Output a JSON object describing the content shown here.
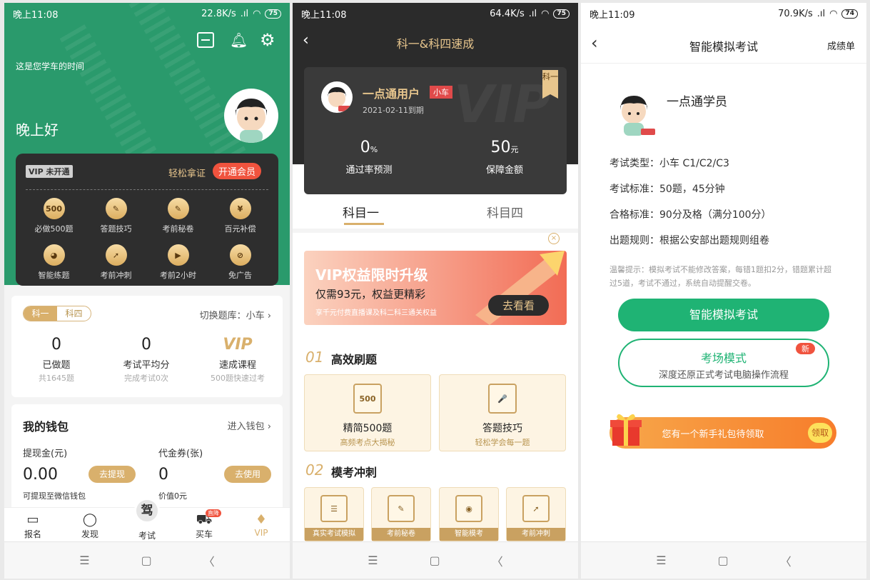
{
  "p1": {
    "status": {
      "time": "晚上11:08",
      "speed": "22.8K/s",
      "battery": "75"
    },
    "tagline": "这是您学车的时间",
    "greeting": "晚上好",
    "vip": {
      "badge": "VIP 未开通",
      "slogan": "轻松拿证",
      "open_btn": "开通会员",
      "items": [
        {
          "icon": "500",
          "label": "必做500题"
        },
        {
          "icon": "✎",
          "label": "答题技巧"
        },
        {
          "icon": "✎",
          "label": "考前秘卷"
        },
        {
          "icon": "¥",
          "label": "百元补偿"
        },
        {
          "icon": "◕",
          "label": "智能练题"
        },
        {
          "icon": "➚",
          "label": "考前冲刺"
        },
        {
          "icon": "▶",
          "label": "考前2小时"
        },
        {
          "icon": "⊘",
          "label": "免广告"
        }
      ]
    },
    "practice": {
      "tabs": [
        "科一",
        "科四"
      ],
      "switch_bank": "切换题库：小车",
      "stats": [
        {
          "num": "0",
          "label": "已做题",
          "sub": "共1645题"
        },
        {
          "num": "0",
          "label": "考试平均分",
          "sub": "完成考试0次"
        },
        {
          "num": "VIP",
          "label": "速成课程",
          "sub": "500题快速过考"
        }
      ]
    },
    "wallet": {
      "title": "我的钱包",
      "enter": "进入钱包",
      "cash_label": "提现金(元)",
      "cash_value": "0.00",
      "cash_btn": "去提现",
      "cash_sub": "可提现至微信钱包",
      "voucher_label": "代金券(张)",
      "voucher_value": "0",
      "voucher_btn": "去使用",
      "voucher_sub": "价值0元"
    },
    "tabbar": [
      {
        "label": "报名",
        "icon": "▭"
      },
      {
        "label": "发现",
        "icon": "◯"
      },
      {
        "label": "考试",
        "icon": "驾"
      },
      {
        "label": "买车",
        "icon": "⛟",
        "badge": "直降"
      },
      {
        "label": "VIP",
        "icon": "♦"
      }
    ]
  },
  "p2": {
    "status": {
      "time": "晚上11:08",
      "speed": "64.4K/s",
      "battery": "75"
    },
    "title": "科一&科四速成",
    "user": {
      "name": "一点通用户",
      "tag": "小车",
      "expire": "2021-02-11到期",
      "ribbon": "科一"
    },
    "pass_rate": {
      "value": "0",
      "unit": "%",
      "label": "通过率预测"
    },
    "guarantee": {
      "value": "50",
      "unit": "元",
      "label": "保障金额"
    },
    "subject_tabs": [
      "科目一",
      "科目四"
    ],
    "banner": {
      "title": "VIP权益限时升级",
      "subtitle": "仅需93元，权益更精彩",
      "desc": "享千元付费直播课及科二科三通关权益",
      "btn": "去看看"
    },
    "sec1": {
      "num": "01",
      "title": "高效刷题",
      "cards": [
        {
          "icon": "500",
          "title": "精简500题",
          "sub": "高频考点大揭秘"
        },
        {
          "icon": "🎤",
          "title": "答题技巧",
          "sub": "轻松学会每一题"
        }
      ]
    },
    "sec2": {
      "num": "02",
      "title": "模考冲刺",
      "cards": [
        {
          "icon": "☰",
          "label": "真实考试模拟"
        },
        {
          "icon": "✎",
          "label": "考前秘卷"
        },
        {
          "icon": "◉",
          "label": "智能模考"
        },
        {
          "icon": "➚",
          "label": "考前冲刺"
        }
      ]
    }
  },
  "p3": {
    "status": {
      "time": "晚上11:09",
      "speed": "70.9K/s",
      "battery": "74"
    },
    "title": "智能模拟考试",
    "report": "成绩单",
    "user": "一点通学员",
    "info": [
      {
        "k": "考试类型：",
        "v": "小车 C1/C2/C3"
      },
      {
        "k": "考试标准：",
        "v": "50题，45分钟"
      },
      {
        "k": "合格标准：",
        "v": "90分及格（满分100分）"
      },
      {
        "k": "出题规则：",
        "v": "根据公安部出题规则组卷"
      }
    ],
    "tip": "温馨提示：模拟考试不能修改答案，每错1题扣2分，错题累计超过5道，考试不通过，系统自动提醒交卷。",
    "btn_exam": "智能模拟考试",
    "btn_hall": {
      "title": "考场模式",
      "sub": "深度还原正式考试电脑操作流程",
      "badge": "新"
    },
    "gift": {
      "text": "您有一个新手礼包待领取",
      "btn": "领取"
    }
  },
  "sysnav": [
    "☰",
    "▢",
    "〈"
  ]
}
